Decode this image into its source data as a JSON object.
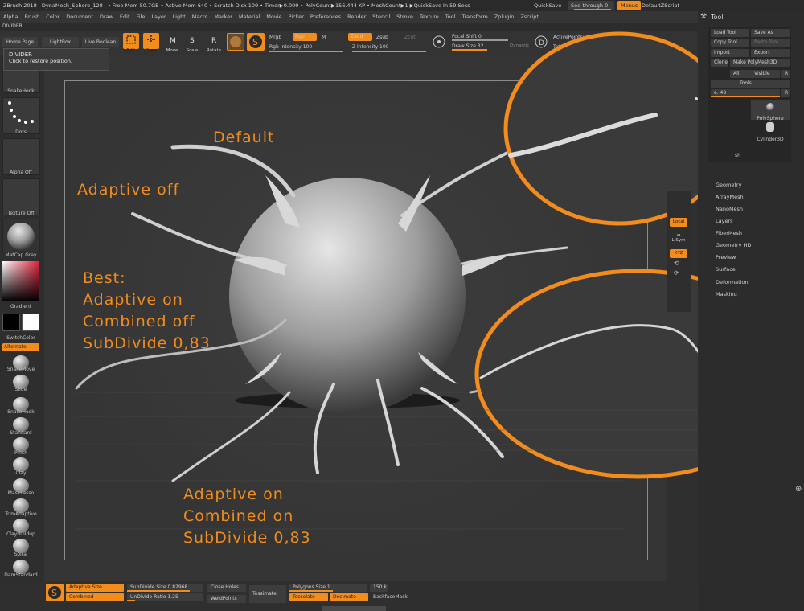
{
  "titlebar": {
    "app": "ZBrush 2018",
    "tool_name": "DynaMesh_Sphere_128",
    "stats": "• Free Mem 50.7GB • Active Mem 640 • Scratch Disk 109 • Timer▶0.009 • PolyCount▶156.444 KP • MeshCount▶1 ▶QuickSave In 59 Secs",
    "quicksave": "QuickSave",
    "see_through": "See-through  0",
    "menus": "Menus",
    "zscript": "DefaultZScript"
  },
  "menu": [
    "Alpha",
    "Brush",
    "Color",
    "Document",
    "Draw",
    "Edit",
    "File",
    "Layer",
    "Light",
    "Macro",
    "Marker",
    "Material",
    "Movie",
    "Picker",
    "Preferences",
    "Render",
    "Stencil",
    "Stroke",
    "Texture",
    "Tool",
    "Transform",
    "Zplugin",
    "Zscript"
  ],
  "divider_label": "DIVIDER",
  "tooltip": {
    "title": "DIVIDER",
    "text": "Click to restore position."
  },
  "toolbar": {
    "home_page": "Home Page",
    "lightbox": "LightBox",
    "live_boolean": "Live Boolean",
    "edit": "Edit",
    "draw": "Draw",
    "move": "Move",
    "scale": "Scale",
    "rotate": "Rotate",
    "mrgb": "Mrgb",
    "rgb": "Rgb",
    "m": "M",
    "zadd": "Zadd",
    "zsub": "Zsub",
    "zcut": "Zcut",
    "rgb_intensity": "Rgb Intensity 100",
    "z_intensity": "Z Intensity 100",
    "focal_shift": "Focal Shift 0",
    "draw_size": "Draw Size 32",
    "dynamic": "Dynamic",
    "active_points": "ActivePoints: 15",
    "total_points": "TotalPoints"
  },
  "left_shelf": {
    "thumbs": [
      "SnakeHook",
      "Dots",
      "Alpha Off",
      "Texture Off",
      "MatCap Gray"
    ],
    "gradient": "Gradient",
    "switch_color": "SwitchColor",
    "alternate": "Alternate",
    "brushes": [
      "SnakeMove",
      "Slide",
      "SnakeHook",
      "Standard",
      "Pinch",
      "Clay",
      "MaskLasso",
      "TrimAdaptive",
      "ClayBuildup",
      "Spiral",
      "DamStandard"
    ]
  },
  "annotations": {
    "default": "Default",
    "adaptive_off": "Adaptive off",
    "best": [
      "Best:",
      "Adaptive on",
      "Combined off",
      "SubDivide 0,83"
    ],
    "combined_on": [
      "Adaptive on",
      "Combined on",
      "SubDivide 0,83"
    ]
  },
  "right_shelf": {
    "local": "Local",
    "lsym": "L.Sym",
    "xyz": "XYZ"
  },
  "tool_panel": {
    "header": "Tool",
    "load_tool": "Load Tool",
    "save_as": "Save As",
    "copy_tool": "Copy Tool",
    "paste_tool": "Paste Tool",
    "import": "Import",
    "export": "Export",
    "clone": "Clone",
    "make_polymesh": "Make PolyMesh3D",
    "all": "All",
    "visible": "Visible",
    "r": "R",
    "tools": "Tools",
    "slider": "e. 48",
    "polysphere": "PolySphere",
    "cylinder": "Cylinder3D",
    "mesh": "sh",
    "menus": [
      "Geometry",
      "ArrayMesh",
      "NanoMesh",
      "Layers",
      "FiberMesh",
      "Geometry HD",
      "Preview",
      "Surface",
      "Deformation",
      "Masking"
    ]
  },
  "bottom_bar": {
    "adaptive_size": "Adaptive Size",
    "combined": "Combined",
    "subdivide_size": "SubDivide Size 0.82968",
    "undivide_ratio": "UnDivide Ratio 1.25",
    "close_holes": "Close Holes",
    "weld_points": "WeldPoints",
    "tessimate": "Tessimate",
    "polygons_size": "Polygons Size 1",
    "poly_count": "150 k",
    "tesselate": "Tesselate",
    "decimate": "Decimate",
    "backface_mask": "BackfaceMask"
  }
}
